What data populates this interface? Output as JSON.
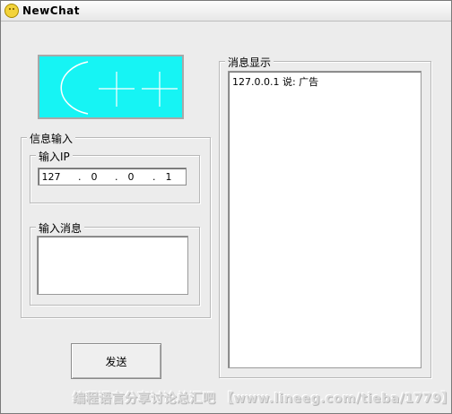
{
  "window": {
    "title": "NewChat"
  },
  "logo": {
    "name": "logo-graphic",
    "accent_color": "#16f4f4"
  },
  "input_group": {
    "title": "信息输入",
    "ip_group": {
      "title": "输入IP",
      "ip_segments": [
        "127",
        "0",
        "0",
        "1"
      ]
    },
    "message_group": {
      "title": "输入消息",
      "value": ""
    }
  },
  "display_group": {
    "title": "消息显示",
    "messages": [
      "127.0.0.1 说: 广告"
    ]
  },
  "send_button": {
    "label": "发送"
  },
  "watermark": {
    "text": "编程语言分享讨论总汇吧 【www.lineeg.com/tieba/1779】"
  }
}
